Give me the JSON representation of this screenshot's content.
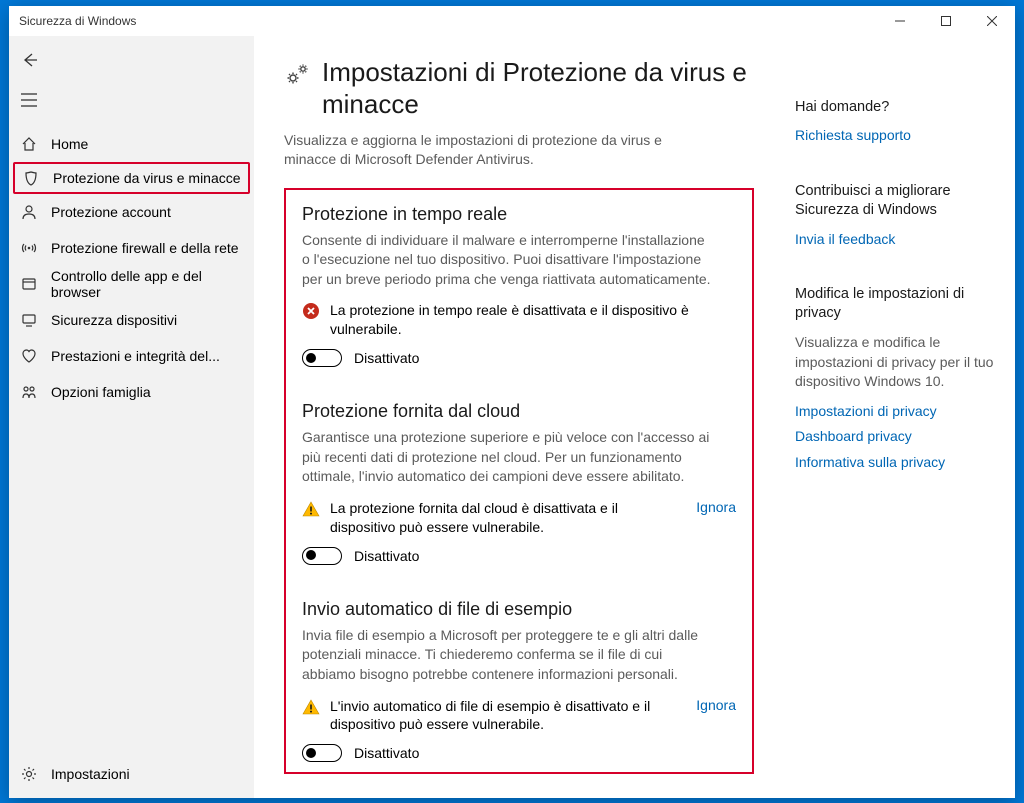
{
  "window": {
    "title": "Sicurezza di Windows"
  },
  "nav": {
    "home": "Home",
    "virus": "Protezione da virus e minacce",
    "account": "Protezione account",
    "firewall": "Protezione firewall e della rete",
    "appbrowser": "Controllo delle app e del browser",
    "device": "Sicurezza dispositivi",
    "health": "Prestazioni e integrità del...",
    "family": "Opzioni famiglia",
    "settings": "Impostazioni"
  },
  "page": {
    "title": "Impostazioni di Protezione da virus e minacce",
    "subtitle": "Visualizza e aggiorna le impostazioni di protezione da virus e minacce di Microsoft Defender Antivirus."
  },
  "sections": {
    "realtime": {
      "title": "Protezione in tempo reale",
      "desc": "Consente di individuare il malware e interromperne l'installazione o l'esecuzione nel tuo dispositivo. Puoi disattivare l'impostazione per un breve periodo prima che venga riattivata automaticamente.",
      "alert": "La protezione in tempo reale è disattivata e il dispositivo è vulnerabile.",
      "toggle": "Disattivato"
    },
    "cloud": {
      "title": "Protezione fornita dal cloud",
      "desc": "Garantisce una protezione superiore e più veloce con l'accesso ai più recenti dati di protezione nel cloud. Per un funzionamento ottimale, l'invio automatico dei campioni deve essere abilitato.",
      "alert": "La protezione fornita dal cloud è disattivata e il dispositivo può essere vulnerabile.",
      "dismiss": "Ignora",
      "toggle": "Disattivato"
    },
    "sample": {
      "title": "Invio automatico di file di esempio",
      "desc": "Invia file di esempio a Microsoft per proteggere te e gli altri dalle potenziali minacce. Ti chiederemo conferma se il file di cui abbiamo bisogno potrebbe contenere informazioni personali.",
      "alert": "L'invio automatico di file di esempio è disattivato e il dispositivo può essere vulnerabile.",
      "dismiss": "Ignora",
      "toggle": "Disattivato"
    }
  },
  "aside": {
    "questions": {
      "title": "Hai domande?",
      "link": "Richiesta supporto"
    },
    "feedback": {
      "title": "Contribuisci a migliorare Sicurezza di Windows",
      "link": "Invia il feedback"
    },
    "privacy": {
      "title": "Modifica le impostazioni di privacy",
      "text": "Visualizza e modifica le impostazioni di privacy per il tuo dispositivo Windows 10.",
      "link1": "Impostazioni di privacy",
      "link2": "Dashboard privacy",
      "link3": "Informativa sulla privacy"
    }
  }
}
